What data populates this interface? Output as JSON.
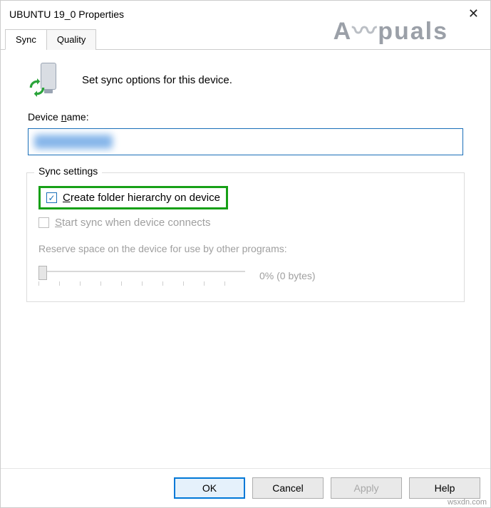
{
  "window": {
    "title": "UBUNTU 19_0 Properties"
  },
  "watermark": {
    "text": "A puals"
  },
  "tabs": [
    {
      "label": "Sync",
      "active": true
    },
    {
      "label": "Quality",
      "active": false
    }
  ],
  "intro": {
    "text": "Set sync options for this device."
  },
  "device_name": {
    "label_pre": "Device ",
    "label_accel": "n",
    "label_post": "ame:",
    "value": ""
  },
  "sync_settings": {
    "legend": "Sync settings",
    "create_hier": {
      "checked": true,
      "accel": "C",
      "rest": "reate folder hierarchy on device"
    },
    "start_sync": {
      "checked": false,
      "accel": "S",
      "rest": "tart sync when device connects"
    },
    "reserve": {
      "label": "Reserve space on the device for use by other programs:",
      "value_text": "0% (0 bytes)"
    }
  },
  "buttons": {
    "ok": "OK",
    "cancel": "Cancel",
    "apply": "Apply",
    "help": "Help"
  },
  "attribution": "wsxdn.com"
}
